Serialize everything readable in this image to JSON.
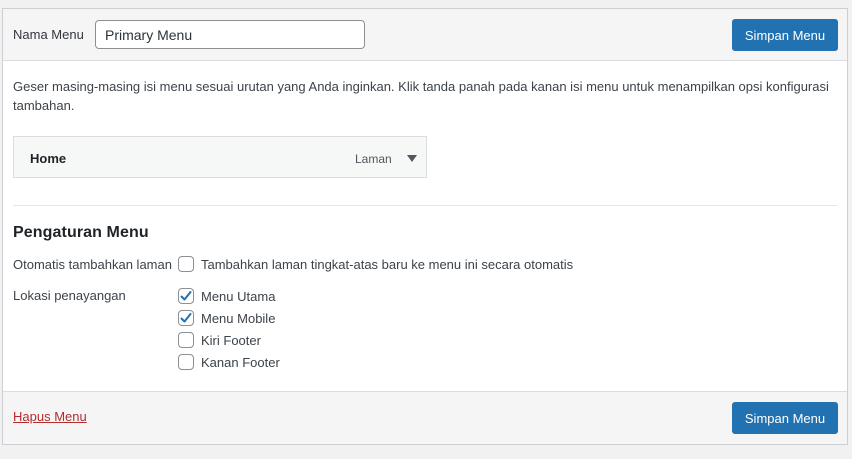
{
  "header": {
    "name_label": "Nama Menu",
    "name_value": "Primary Menu",
    "save_label": "Simpan Menu"
  },
  "instructions": "Geser masing-masing isi menu sesuai urutan yang Anda inginkan. Klik tanda panah pada kanan isi menu untuk menampilkan opsi konfigurasi tambahan.",
  "menu_items": [
    {
      "title": "Home",
      "type": "Laman",
      "icon": "triangle-down-icon"
    }
  ],
  "settings": {
    "title": "Pengaturan Menu",
    "auto_add": {
      "label": "Otomatis tambahkan laman",
      "option": {
        "label": "Tambahkan laman tingkat-atas baru ke menu ini secara otomatis",
        "checked": false
      }
    },
    "locations": {
      "label": "Lokasi penayangan",
      "options": [
        {
          "label": "Menu Utama",
          "checked": true
        },
        {
          "label": "Menu Mobile",
          "checked": true
        },
        {
          "label": "Kiri Footer",
          "checked": false
        },
        {
          "label": "Kanan Footer",
          "checked": false
        }
      ]
    }
  },
  "footer": {
    "delete_label": "Hapus Menu",
    "save_label": "Simpan Menu"
  },
  "colors": {
    "primary": "#2271b1",
    "delete": "#b32d2e",
    "check": "#2271b1"
  }
}
